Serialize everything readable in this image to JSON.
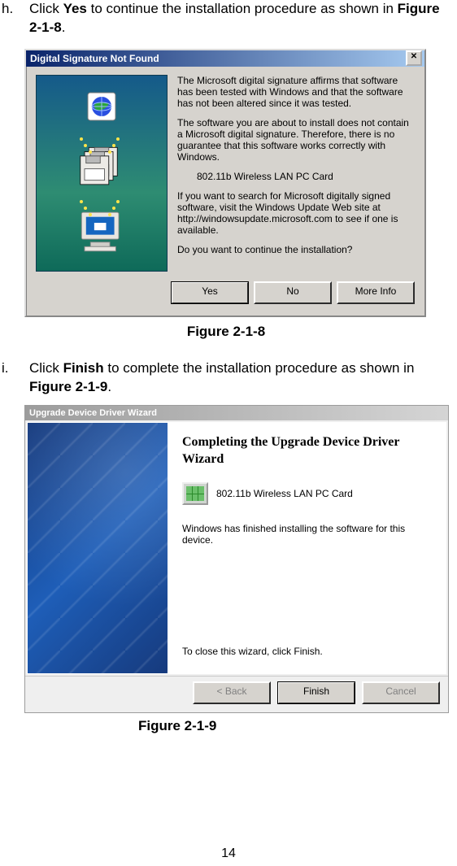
{
  "steps": {
    "h": {
      "bullet": "h.",
      "text_pre": "Click ",
      "bold1": "Yes",
      "mid1": " to continue the installation procedure as shown in ",
      "bold2": "Figure 2-1-8",
      "suffix": "."
    },
    "i": {
      "bullet": "i.",
      "text_pre": "Click ",
      "bold1": "Finish",
      "mid1": " to complete the installation procedure as shown in ",
      "bold2": "Figure 2-1-9",
      "suffix": "."
    }
  },
  "dialog1": {
    "title": "Digital Signature Not Found",
    "p1": "The Microsoft digital signature affirms that software has been tested with Windows and that the software has not been altered since it was tested.",
    "p2": "The software you are about to install does not contain a Microsoft digital signature. Therefore, there is no guarantee that this software works correctly with Windows.",
    "device": "802.11b Wireless LAN PC Card",
    "p3": "If you want to search for Microsoft digitally signed software, visit the Windows Update Web site at http://windowsupdate.microsoft.com to see if one is available.",
    "p4": "Do you want to continue the installation?",
    "btn_yes": "Yes",
    "btn_no": "No",
    "btn_more": "More Info"
  },
  "dialog2": {
    "title": "Upgrade Device Driver Wizard",
    "heading": "Completing the Upgrade Device Driver Wizard",
    "device": "802.11b Wireless LAN PC Card",
    "done_line": "Windows has finished installing the software for this device.",
    "close_line": "To close this wizard, click Finish.",
    "btn_back": "< Back",
    "btn_finish": "Finish",
    "btn_cancel": "Cancel"
  },
  "captions": {
    "c1": "Figure 2-1-8",
    "c2": "Figure 2-1-9"
  },
  "page_number": "14"
}
